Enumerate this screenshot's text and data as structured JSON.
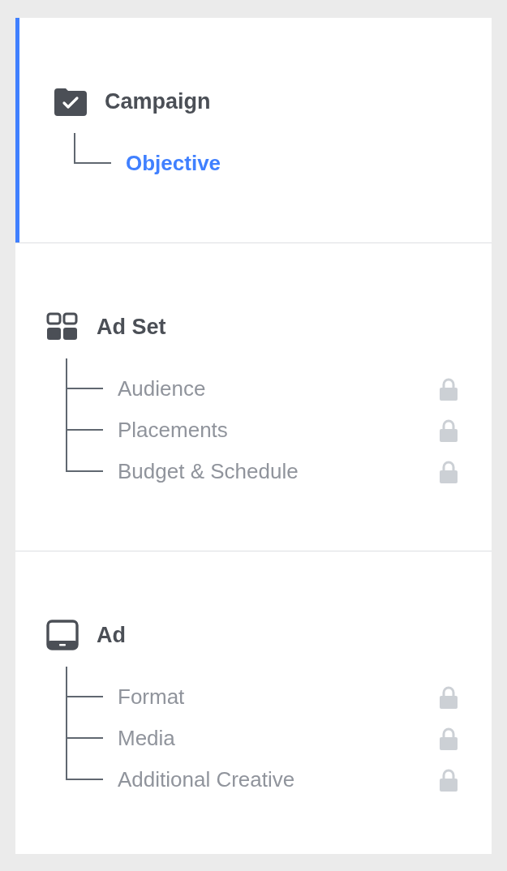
{
  "sections": [
    {
      "title": "Campaign",
      "kind": "campaign",
      "selected": true,
      "items": [
        {
          "label": "Objective",
          "selected": true,
          "locked": false
        }
      ]
    },
    {
      "title": "Ad Set",
      "kind": "adset",
      "selected": false,
      "items": [
        {
          "label": "Audience",
          "selected": false,
          "locked": true
        },
        {
          "label": "Placements",
          "selected": false,
          "locked": true
        },
        {
          "label": "Budget & Schedule",
          "selected": false,
          "locked": true
        }
      ]
    },
    {
      "title": "Ad",
      "kind": "ad",
      "selected": false,
      "items": [
        {
          "label": "Format",
          "selected": false,
          "locked": true
        },
        {
          "label": "Media",
          "selected": false,
          "locked": true
        },
        {
          "label": "Additional Creative",
          "selected": false,
          "locked": true
        }
      ]
    }
  ]
}
